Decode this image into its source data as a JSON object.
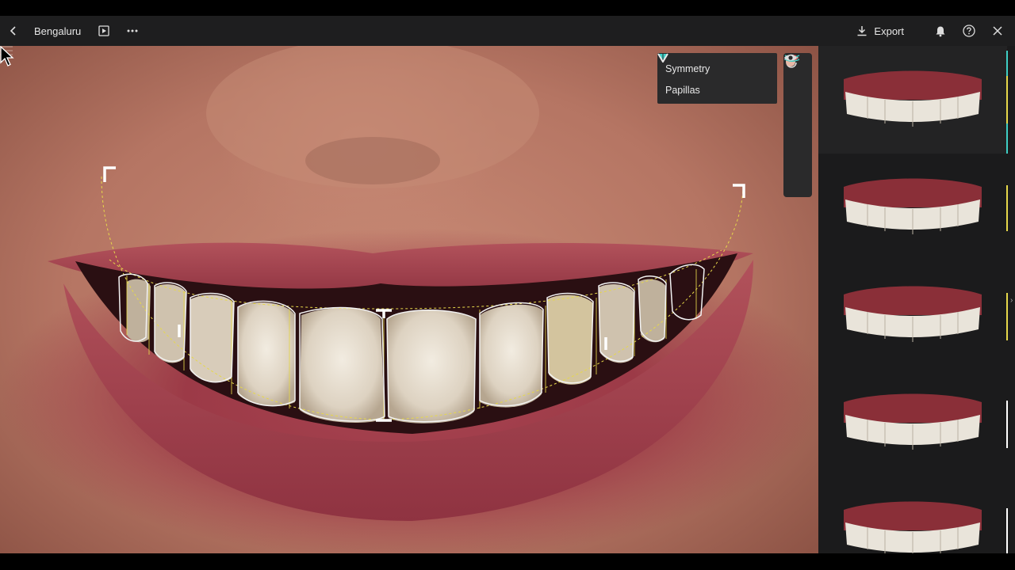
{
  "topbar": {
    "title": "Bengaluru",
    "export_label": "Export",
    "icons": [
      "back-icon",
      "play-icon",
      "more-icon",
      "download-icon",
      "bell-icon",
      "help-icon",
      "close-icon"
    ]
  },
  "options_panel": {
    "items": [
      {
        "label": "Symmetry",
        "icon": "symmetry-toggle-icon",
        "color": "#3ecfc5"
      },
      {
        "label": "Papillas",
        "icon": "papillas-toggle-icon",
        "color": "#e8e8e8"
      }
    ]
  },
  "tools": [
    "rotate-tool-icon",
    "curve-tool-icon",
    "color-tool-icon",
    "smile-arc-tool-icon",
    "visibility-icon"
  ],
  "smile_library": {
    "count": 5,
    "selected_index": 0,
    "indicator_colors": [
      "#3ecfc5",
      "#e6d84a",
      "#e6d84a",
      "#ffffff",
      "#ffffff"
    ]
  },
  "colors": {
    "accent_teal": "#3ecfc5",
    "guide_yellow": "#e6d84a",
    "topbar": "#1e1e1f",
    "sidebar": "#1b1b1c"
  }
}
